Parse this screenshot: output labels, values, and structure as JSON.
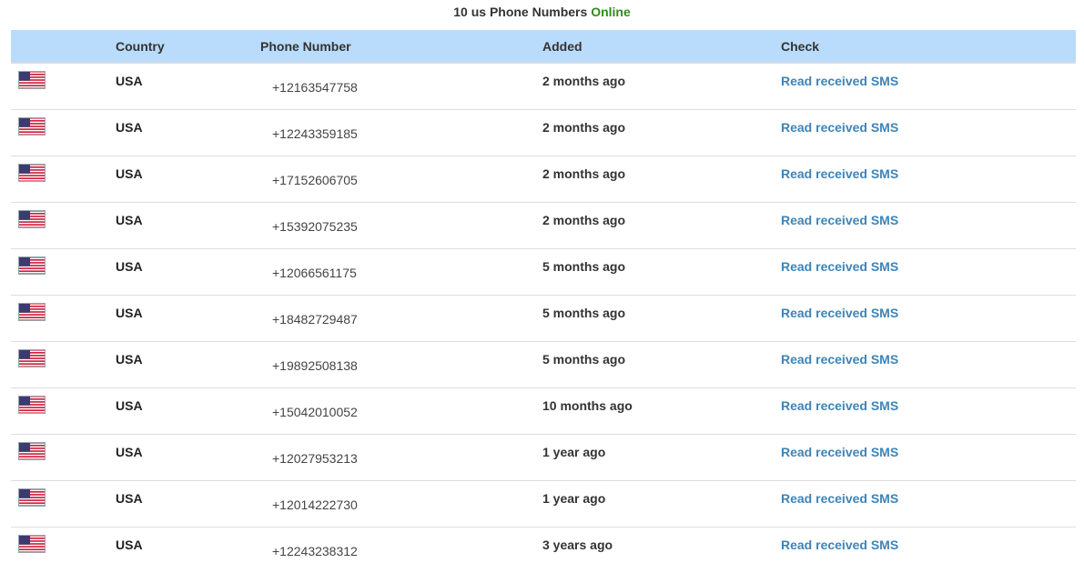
{
  "heading": {
    "prefix": "10 us Phone Numbers",
    "status": "Online"
  },
  "colors": {
    "header_bg": "#b9dbfc",
    "link": "#3d84b8",
    "online": "#2e8b17"
  },
  "table": {
    "columns": [
      "",
      "Country",
      "Phone Number",
      "Added",
      "Check"
    ],
    "rows": [
      {
        "flag": "us-flag-icon",
        "country": "USA",
        "phone": "+12163547758",
        "added": "2 months ago",
        "check": "Read received SMS"
      },
      {
        "flag": "us-flag-icon",
        "country": "USA",
        "phone": "+12243359185",
        "added": "2 months ago",
        "check": "Read received SMS"
      },
      {
        "flag": "us-flag-icon",
        "country": "USA",
        "phone": "+17152606705",
        "added": "2 months ago",
        "check": "Read received SMS"
      },
      {
        "flag": "us-flag-icon",
        "country": "USA",
        "phone": "+15392075235",
        "added": "2 months ago",
        "check": "Read received SMS"
      },
      {
        "flag": "us-flag-icon",
        "country": "USA",
        "phone": "+12066561175",
        "added": "5 months ago",
        "check": "Read received SMS"
      },
      {
        "flag": "us-flag-icon",
        "country": "USA",
        "phone": "+18482729487",
        "added": "5 months ago",
        "check": "Read received SMS"
      },
      {
        "flag": "us-flag-icon",
        "country": "USA",
        "phone": "+19892508138",
        "added": "5 months ago",
        "check": "Read received SMS"
      },
      {
        "flag": "us-flag-icon",
        "country": "USA",
        "phone": "+15042010052",
        "added": "10 months ago",
        "check": "Read received SMS"
      },
      {
        "flag": "us-flag-icon",
        "country": "USA",
        "phone": "+12027953213",
        "added": "1 year ago",
        "check": "Read received SMS"
      },
      {
        "flag": "us-flag-icon",
        "country": "USA",
        "phone": "+12014222730",
        "added": "1 year ago",
        "check": "Read received SMS"
      },
      {
        "flag": "us-flag-icon",
        "country": "USA",
        "phone": "+12243238312",
        "added": "3 years ago",
        "check": "Read received SMS"
      }
    ]
  }
}
